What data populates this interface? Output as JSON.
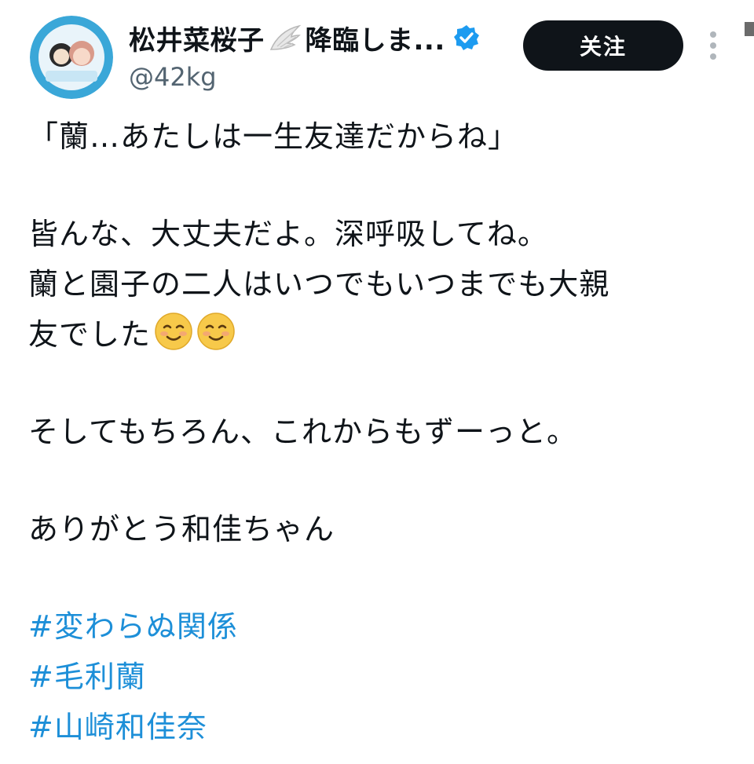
{
  "author": {
    "display_name": "松井菜桜子",
    "display_name_tail": "降臨しま...",
    "handle": "@42kg"
  },
  "actions": {
    "follow_label": "关注"
  },
  "post": {
    "quote": "「蘭…あたしは一生友達だからね」",
    "paragraph1_line1": "皆んな、大丈夫だよ。深呼吸してね。",
    "paragraph1_line2": "蘭と園子の二人はいつでもいつまでも大親",
    "paragraph1_line3": "友でした",
    "paragraph2": "そしてもちろん、これからもずーっと。",
    "paragraph3": "ありがとう和佳ちゃん",
    "hashtags": [
      "#変わらぬ関係",
      "#毛利蘭",
      "#山崎和佳奈"
    ]
  },
  "colors": {
    "hashtag": "#1d8fd8",
    "verified": "#1d9bf0",
    "follow_bg": "#0f1419",
    "handle": "#536471"
  },
  "icons": {
    "verified": "verified-badge-icon",
    "wing": "angel-wing-icon",
    "more": "vertical-dots-icon",
    "emoji": "smiling-face-icon"
  }
}
